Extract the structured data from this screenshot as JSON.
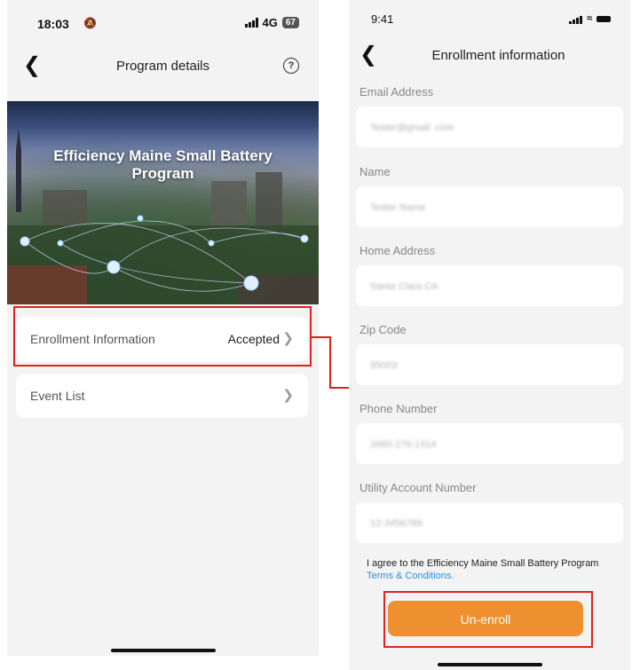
{
  "left_screen": {
    "status": {
      "time": "18:03",
      "network": "4G",
      "battery": "67"
    },
    "nav": {
      "title": "Program details"
    },
    "banner": {
      "title": "Efficiency Maine Small Battery Program"
    },
    "rows": [
      {
        "label": "Enrollment Information",
        "value": "Accepted"
      },
      {
        "label": "Event List",
        "value": ""
      }
    ]
  },
  "right_screen": {
    "status": {
      "time": "9:41"
    },
    "nav": {
      "title": "Enrollment information"
    },
    "fields": [
      {
        "label": "Email Address",
        "value": "Tester@gmail .com"
      },
      {
        "label": "Name",
        "value": "Tester Name"
      },
      {
        "label": "Home Address",
        "value": "Santa Clara CA"
      },
      {
        "label": "Zip Code",
        "value": "95003"
      },
      {
        "label": "Phone Number",
        "value": "3480-276-1414"
      },
      {
        "label": "Utility Account Number",
        "value": "12-3456789"
      }
    ],
    "agreement": {
      "text": "I agree to the Efficiency Maine Small Battery Program",
      "link": "Terms & Conditions."
    },
    "unenroll_label": "Un-enroll"
  },
  "colors": {
    "accent": "#ee9030",
    "link": "#2b8fe6",
    "highlight": "#e02020",
    "background": "#f3f3f3"
  },
  "icons": [
    "back-chevron-icon",
    "help-icon",
    "chevron-right-icon",
    "signal-icon",
    "wifi-icon",
    "battery-icon",
    "mute-bell-icon"
  ]
}
